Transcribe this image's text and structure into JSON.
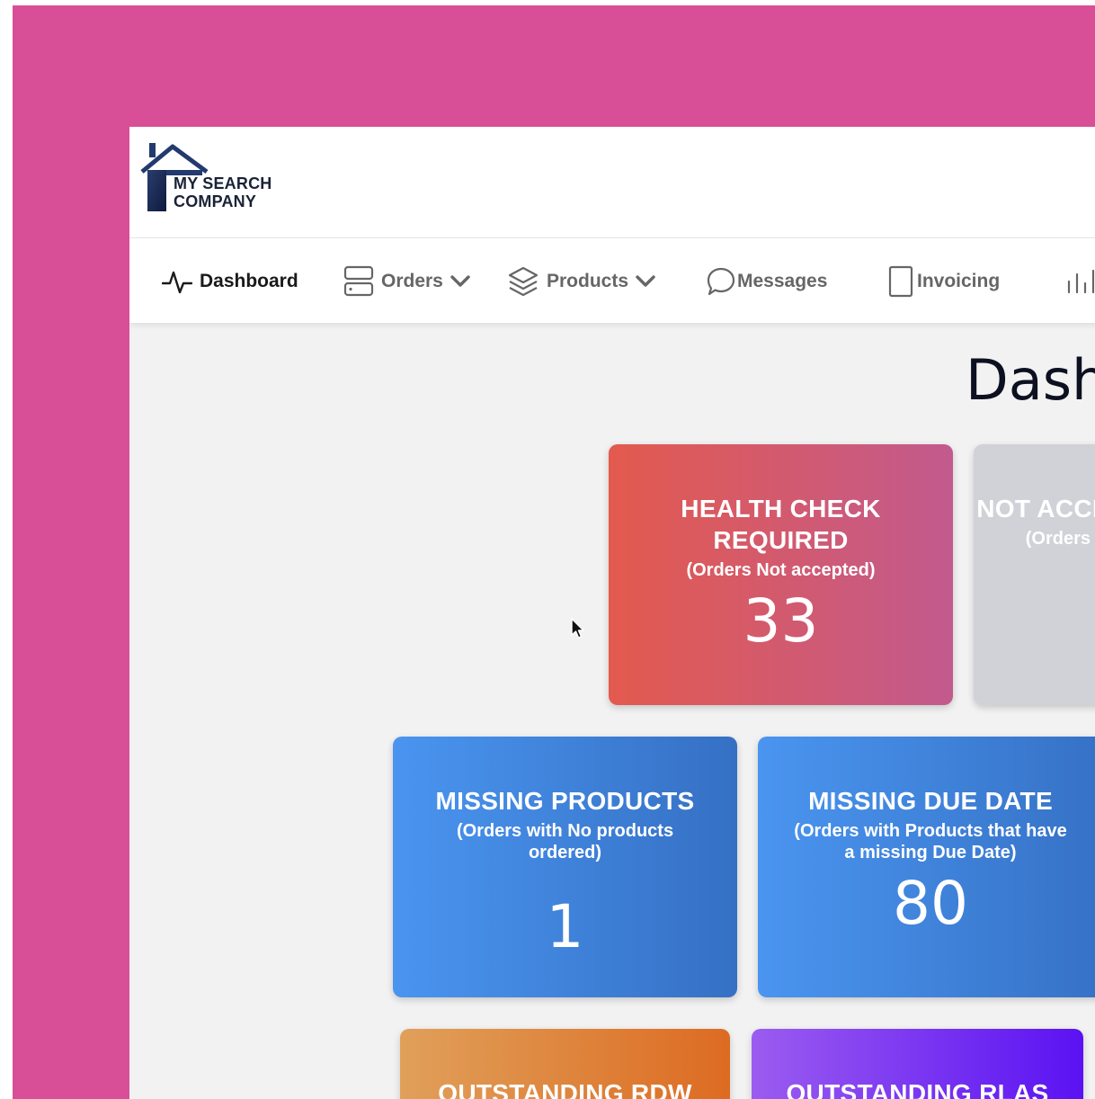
{
  "brand": {
    "line1": "MY SEARCH",
    "line2": "COMPANY"
  },
  "nav": {
    "dashboard": "Dashboard",
    "orders": "Orders",
    "products": "Products",
    "messages": "Messages",
    "invoicing": "Invoicing"
  },
  "page": {
    "title": "Dashboard"
  },
  "cards": {
    "health": {
      "title_1": "HEALTH CHECK",
      "title_2": "REQUIRED",
      "sub": "(Orders Not accepted)",
      "value": "33"
    },
    "not_accepted": {
      "title": "NOT ACCEPTED",
      "sub": "(Orders that"
    },
    "missing_products": {
      "title": "MISSING PRODUCTS",
      "sub_1": "(Orders with No products",
      "sub_2": "ordered)",
      "value": "1"
    },
    "missing_due": {
      "title": "MISSING DUE DATE",
      "sub_1": "(Orders with Products that have",
      "sub_2": "a missing Due Date)",
      "value": "80"
    },
    "rdw": {
      "title": "OUTSTANDING RDW"
    },
    "rlas": {
      "title": "OUTSTANDING RLAS"
    }
  },
  "colors": {
    "background": "#d84f97",
    "health_gradient": [
      "#e35a4e",
      "#c25a8e"
    ],
    "blue_gradient": [
      "#4a95f0",
      "#3570c4"
    ],
    "orange_gradient": [
      "#e0a05a",
      "#dd6b22"
    ],
    "purple_gradient": [
      "#9b5cf0",
      "#5a12f2"
    ],
    "grey_card": "#d0d2d8"
  }
}
